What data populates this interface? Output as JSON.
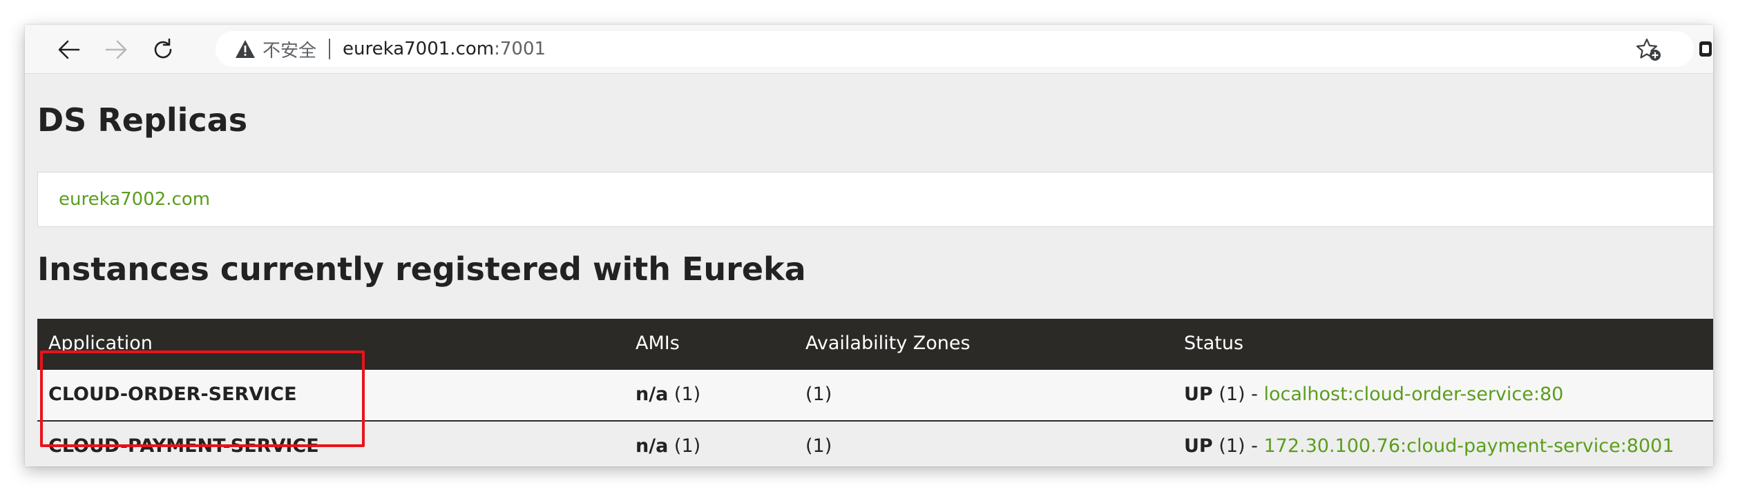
{
  "browser": {
    "insecure_label": "不安全",
    "host": "eureka7001.com",
    "port": ":7001"
  },
  "page": {
    "replicas_title": "DS Replicas",
    "replica_link": "eureka7002.com",
    "instances_title": "Instances currently registered with Eureka"
  },
  "table": {
    "headers": [
      "Application",
      "AMIs",
      "Availability Zones",
      "Status"
    ],
    "rows": [
      {
        "application": "CLOUD-ORDER-SERVICE",
        "ami_value": "n/a",
        "ami_count": "(1)",
        "zones": "(1)",
        "status": "UP",
        "status_count": "(1) -",
        "instance_link": "localhost:cloud-order-service:80"
      },
      {
        "application": "CLOUD-PAYMENT-SERVICE",
        "ami_value": "n/a",
        "ami_count": "(1)",
        "zones": "(1)",
        "status": "UP",
        "status_count": "(1) -",
        "instance_link": "172.30.100.76:cloud-payment-service:8001"
      }
    ]
  },
  "colors": {
    "link": "#5a9e1c",
    "header_bg": "#2b2a26",
    "highlight": "#e8131b"
  },
  "icons": [
    "back-arrow-icon",
    "forward-arrow-icon",
    "reload-icon",
    "warning-icon",
    "star-add-icon",
    "extension-icon"
  ]
}
